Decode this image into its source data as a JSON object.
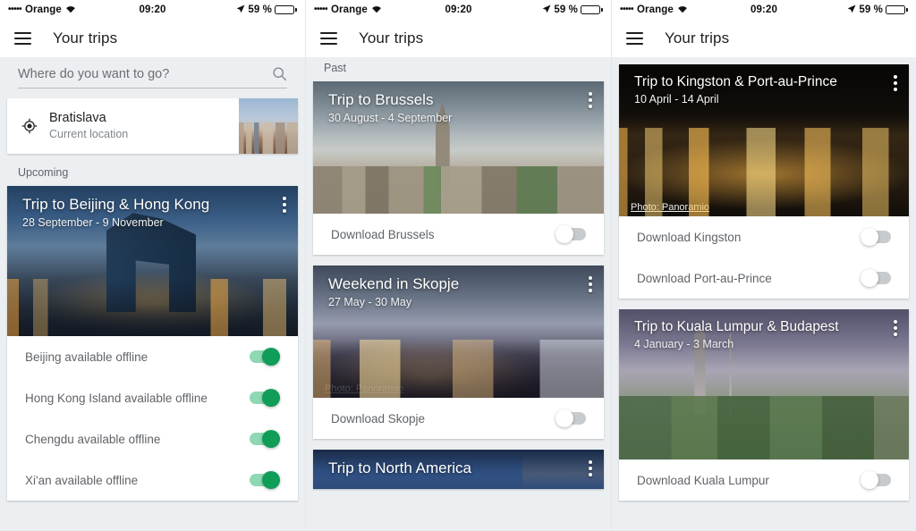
{
  "statusbar": {
    "signal_dots": "•••••",
    "carrier": "Orange",
    "wifi_icon": "wifi-icon",
    "time": "09:20",
    "location_icon": "location-arrow-icon",
    "battery_percent": "59 %",
    "battery_level": 59
  },
  "appbar": {
    "menu_icon": "hamburger-menu-icon",
    "title": "Your trips"
  },
  "search": {
    "placeholder": "Where do you want to go?",
    "value": "",
    "icon": "search-icon"
  },
  "location_card": {
    "icon": "gps-fixed-icon",
    "title": "Bratislava",
    "subtitle": "Current location",
    "thumbnail": "bratislava-skyline-thumbnail"
  },
  "sections": {
    "upcoming": "Upcoming",
    "past": "Past"
  },
  "attribution": "Photo: Panoramio",
  "colors": {
    "toggle_on_thumb": "#0f9d58",
    "toggle_on_track": "#8fd8b4",
    "toggle_off_thumb": "#ffffff",
    "toggle_off_track": "#9aa0a6",
    "background": "#eceff1",
    "card_background": "#ffffff",
    "text_primary": "#202124",
    "text_secondary": "#5f6368"
  },
  "panel1": {
    "trips": [
      {
        "title": "Trip to Beijing & Hong Kong",
        "dates": "28 September - 9 November",
        "menu_icon": "overflow-menu-icon",
        "toggles": [
          {
            "label": "Beijing available offline",
            "state": "on"
          },
          {
            "label": "Hong Kong Island available offline",
            "state": "on"
          },
          {
            "label": "Chengdu available offline",
            "state": "on"
          },
          {
            "label": "Xi'an available offline",
            "state": "on"
          }
        ]
      }
    ]
  },
  "panel2": {
    "trips": [
      {
        "title": "Trip to Brussels",
        "dates": "30 August - 4 September",
        "menu_icon": "overflow-menu-icon",
        "toggles": [
          {
            "label": "Download Brussels",
            "state": "off"
          }
        ]
      },
      {
        "title": "Weekend in Skopje",
        "dates": "27 May - 30 May",
        "menu_icon": "overflow-menu-icon",
        "attribution": "Photo: Panoramio",
        "toggles": [
          {
            "label": "Download Skopje",
            "state": "off"
          }
        ]
      },
      {
        "title": "Trip to North America",
        "dates": "",
        "menu_icon": "overflow-menu-icon",
        "toggles": []
      }
    ]
  },
  "panel3": {
    "trips": [
      {
        "title": "Trip to Kingston & Port-au-Prince",
        "dates": "10 April - 14 April",
        "menu_icon": "overflow-menu-icon",
        "attribution": "Photo: Panoramio",
        "toggles": [
          {
            "label": "Download Kingston",
            "state": "off"
          },
          {
            "label": "Download Port-au-Prince",
            "state": "off"
          }
        ]
      },
      {
        "title": "Trip to Kuala Lumpur & Budapest",
        "dates": "4 January - 3 March",
        "menu_icon": "overflow-menu-icon",
        "toggles": [
          {
            "label": "Download Kuala Lumpur",
            "state": "off"
          }
        ]
      }
    ]
  }
}
